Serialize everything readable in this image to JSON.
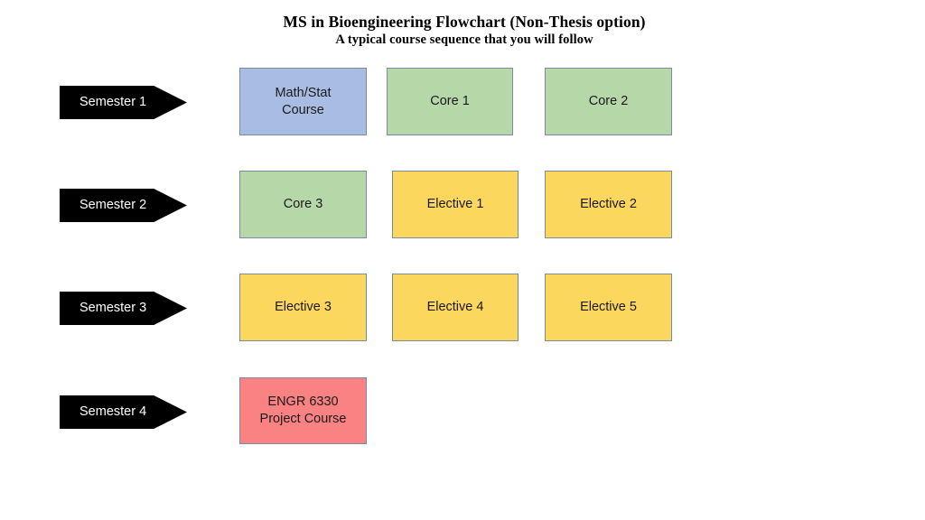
{
  "header": {
    "title": "MS in Bioengineering Flowchart (Non-Thesis option)",
    "subtitle": "A typical course sequence that you will follow"
  },
  "colors": {
    "math_stat": "#A9BCE3",
    "core": "#B6D7A8",
    "elective": "#FCD75E",
    "project": "#FA8282",
    "box_border": "#7A8BA3",
    "semester_arrow": "#000000",
    "semester_arrow_text": "#FFFFFF",
    "background": "#FFFFFF",
    "text": "#1A1A1A"
  },
  "semesters": [
    {
      "label": "Semester 1"
    },
    {
      "label": "Semester 2"
    },
    {
      "label": "Semester 3"
    },
    {
      "label": "Semester 4"
    }
  ],
  "courses": [
    {
      "label": "Math/Stat\nCourse",
      "category": "math_stat",
      "semester": "Semester 1",
      "column": 1
    },
    {
      "label": "Core 1",
      "category": "core",
      "semester": "Semester 1",
      "column": 2
    },
    {
      "label": "Core 2",
      "category": "core",
      "semester": "Semester 1",
      "column": 3
    },
    {
      "label": "Core 3",
      "category": "core",
      "semester": "Semester 2",
      "column": 1
    },
    {
      "label": "Elective 1",
      "category": "elective",
      "semester": "Semester 2",
      "column": 2
    },
    {
      "label": "Elective 2",
      "category": "elective",
      "semester": "Semester 2",
      "column": 3
    },
    {
      "label": "Elective 3",
      "category": "elective",
      "semester": "Semester 3",
      "column": 1
    },
    {
      "label": "Elective 4",
      "category": "elective",
      "semester": "Semester 3",
      "column": 2
    },
    {
      "label": "Elective 5",
      "category": "elective",
      "semester": "Semester 3",
      "column": 3
    },
    {
      "label": "ENGR 6330\nProject Course",
      "category": "project",
      "semester": "Semester 4",
      "column": 1
    }
  ]
}
